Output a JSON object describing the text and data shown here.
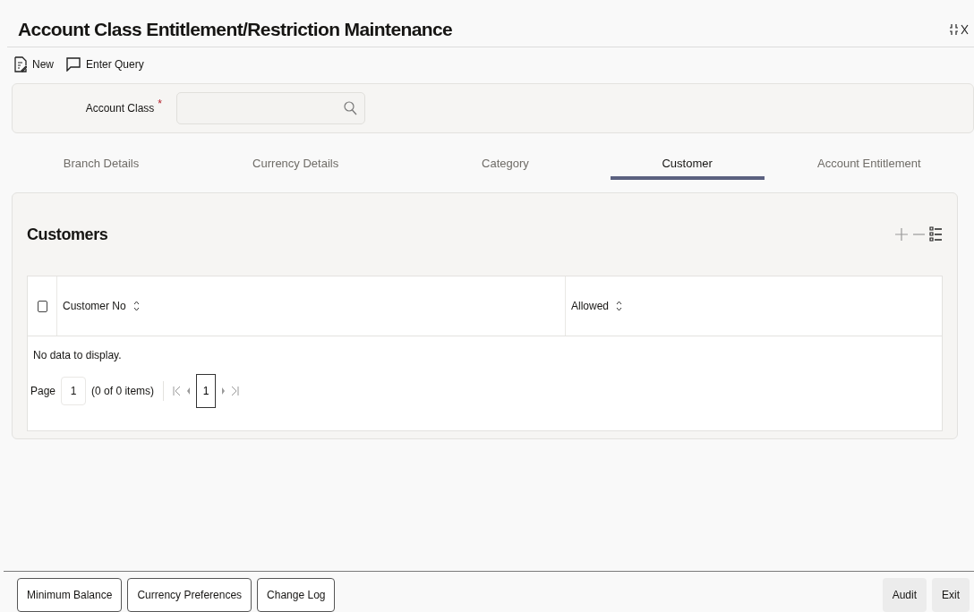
{
  "window": {
    "title": "Account Class Entitlement/Restriction Maintenance"
  },
  "toolbar": [
    {
      "kind": "new",
      "label": "New"
    },
    {
      "kind": "query",
      "label": "Enter Query"
    }
  ],
  "header_field": {
    "label": "Account Class",
    "required_mark": "*"
  },
  "tabs": [
    {
      "label": "Branch Details",
      "selected": false
    },
    {
      "label": "Currency Details",
      "selected": false
    },
    {
      "label": "Category",
      "selected": false
    },
    {
      "label": "Customer",
      "selected": true
    },
    {
      "label": "Account Entitlement",
      "selected": false
    }
  ],
  "section": {
    "title": "Customers"
  },
  "table": {
    "select_all": {
      "checked": false
    },
    "columns": [
      {
        "label": "Customer No"
      },
      {
        "label": "Allowed"
      }
    ],
    "empty_message": "No data to display."
  },
  "pagination": {
    "label": "Page",
    "page_input": "1",
    "summary": "(0 of 0 items)",
    "current": "1"
  },
  "footer": {
    "left_buttons": [
      "Minimum Balance",
      "Currency Preferences",
      "Change Log"
    ],
    "right_buttons": [
      "Audit",
      "Exit"
    ]
  }
}
